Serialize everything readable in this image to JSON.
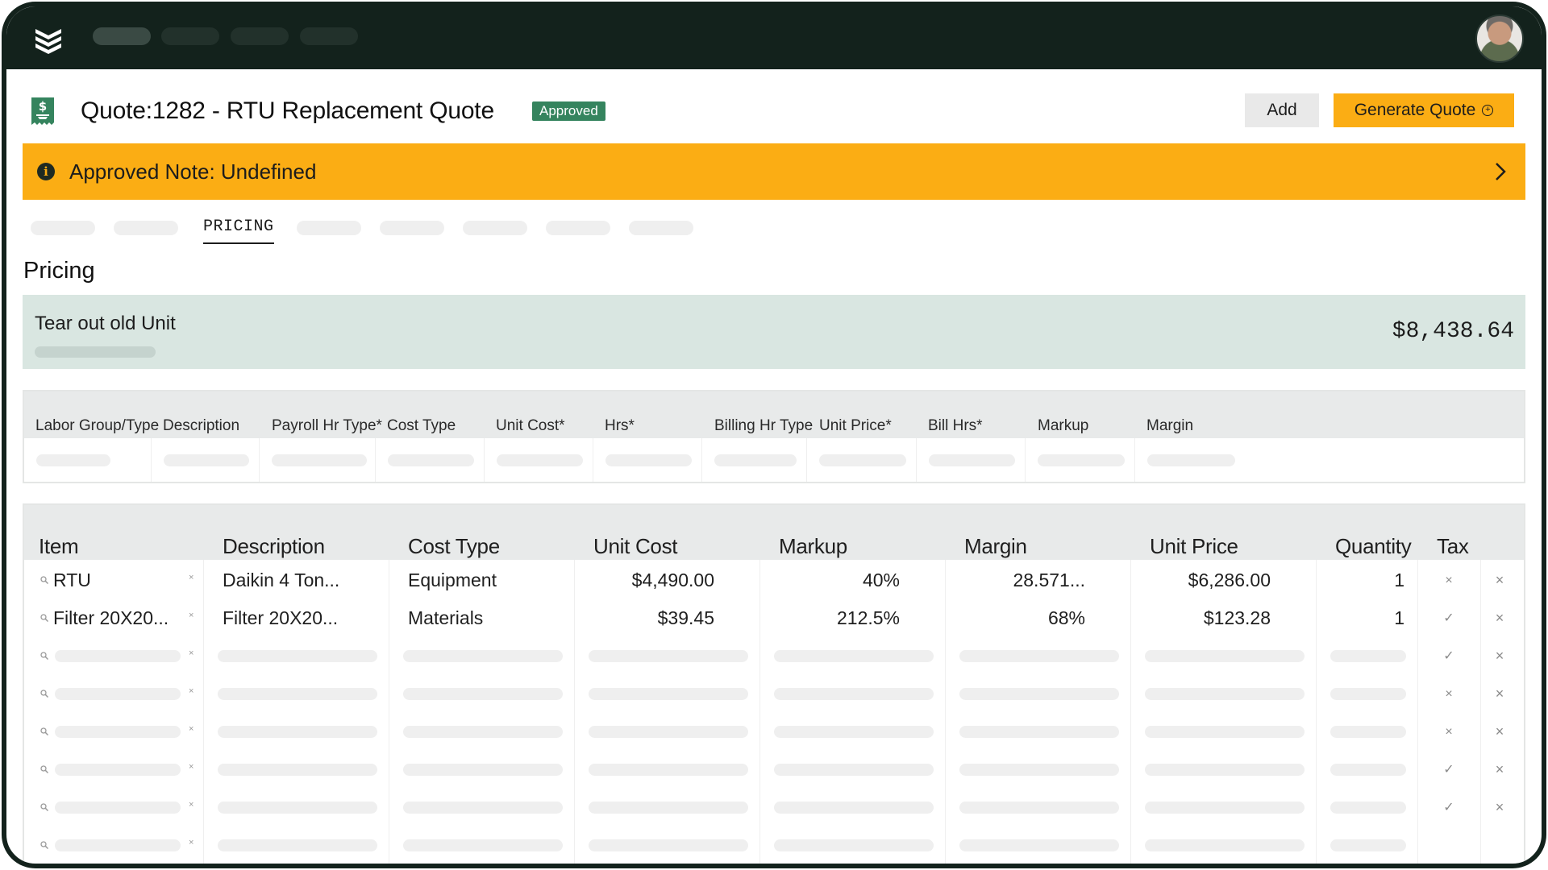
{
  "topbar": {
    "logo": "chevrons-logo-icon",
    "nav_pills": 4,
    "avatar": "user-avatar"
  },
  "header": {
    "title": "Quote:1282 - RTU Replacement Quote",
    "status_badge": "Approved",
    "add_label": "Add",
    "generate_label": "Generate Quote",
    "colors": {
      "accent": "#fbad14",
      "badge": "#35845e",
      "topbar": "#13221c"
    }
  },
  "banner": {
    "text": "Approved Note: Undefined"
  },
  "tabs": {
    "active": "PRICING"
  },
  "section": {
    "title": "Pricing"
  },
  "group": {
    "name": "Tear out old Unit",
    "total": "$8,438.64"
  },
  "labor_table": {
    "headers": [
      "Labor Group/Type",
      "Description",
      "Payroll Hr Type*",
      "Cost Type",
      "Unit Cost*",
      "Hrs*",
      "Billing Hr Type",
      "Unit Price*",
      "Bill Hrs*",
      "Markup",
      "Margin"
    ]
  },
  "items_table": {
    "headers": [
      "Item",
      "Description",
      "Cost Type",
      "Unit Cost",
      "Markup",
      "Margin",
      "Unit Price",
      "Quantity",
      "Tax"
    ],
    "rows": [
      {
        "item": "RTU",
        "description": "Daikin 4 Ton...",
        "cost_type": "Equipment",
        "unit_cost": "$4,490.00",
        "markup": "40%",
        "margin": "28.571...",
        "unit_price": "$6,286.00",
        "quantity": "1",
        "tax": "×"
      },
      {
        "item": "Filter 20X20...",
        "description": "Filter 20X20...",
        "cost_type": "Materials",
        "unit_cost": "$39.45",
        "markup": "212.5%",
        "margin": "68%",
        "unit_price": "$123.28",
        "quantity": "1",
        "tax": "✓"
      }
    ],
    "placeholder_tax": [
      "✓",
      "×",
      "×",
      "✓",
      "✓",
      ""
    ],
    "delete_symbol": "×"
  }
}
